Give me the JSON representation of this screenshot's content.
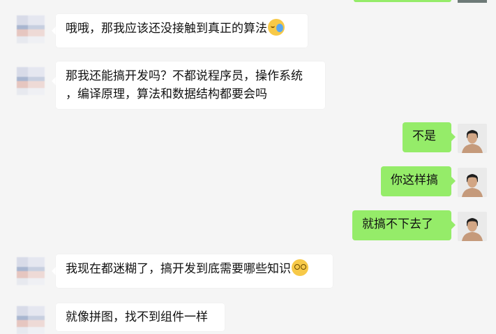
{
  "messages": [
    {
      "side": "left",
      "text": "哦哦，那我应该还没接触到真正的算法",
      "emoji": "crying-laughing-face-icon"
    },
    {
      "side": "left",
      "lines": [
        "那我还能搞开发吗？不都说程序员，操作系统",
        "，编译原理，算法和数据结构都要会吗"
      ]
    },
    {
      "side": "right",
      "text": "不是"
    },
    {
      "side": "right",
      "text": "你这样搞"
    },
    {
      "side": "right",
      "text": "就搞不下去了"
    },
    {
      "side": "left",
      "text": "我现在都迷糊了，搞开发到底需要哪些知识",
      "emoji": "dizzy-face-icon"
    },
    {
      "side": "left",
      "text": "就像拼图，找不到组件一样"
    }
  ],
  "colors": {
    "background": "#f5f5f5",
    "left_bubble": "#ffffff",
    "right_bubble": "#95ec69"
  }
}
